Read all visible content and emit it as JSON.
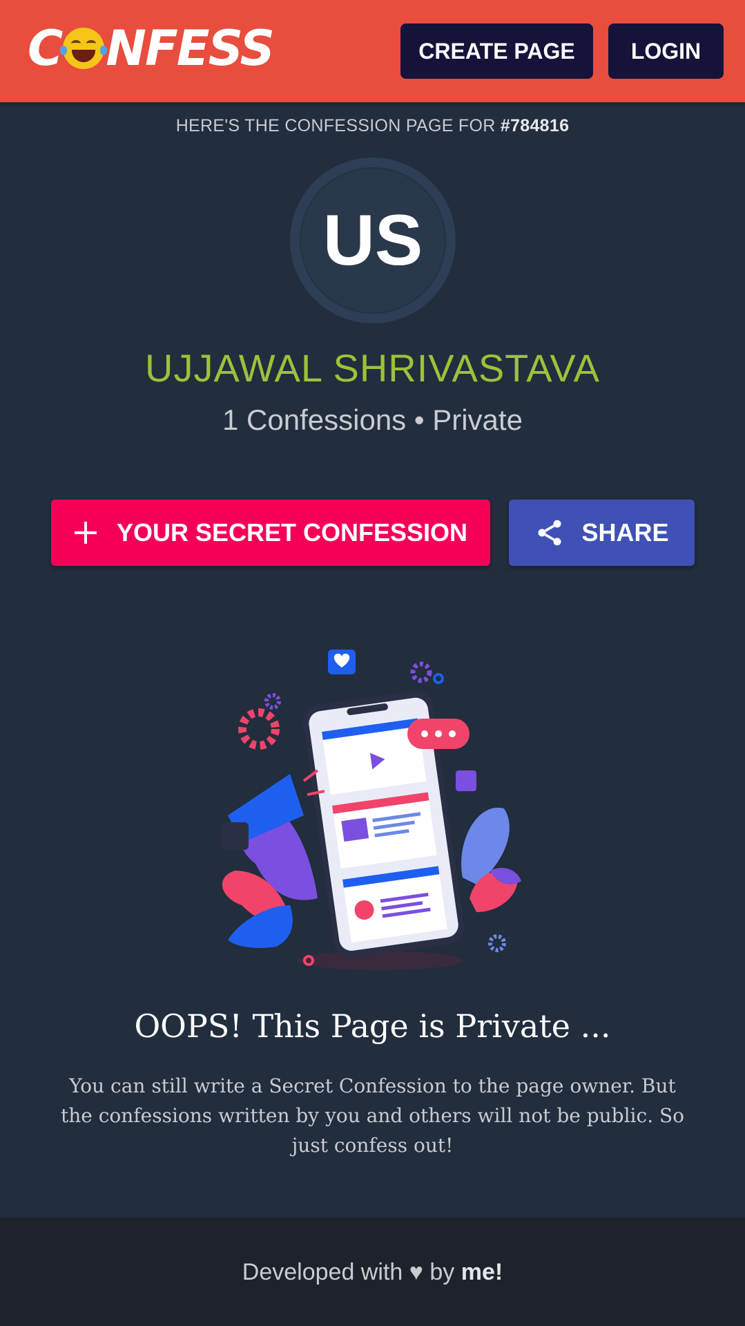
{
  "header": {
    "logo_text_start": "C",
    "logo_text_end": "NFESS",
    "create_page_label": "CREATE PAGE",
    "login_label": "LOGIN",
    "accent_color": "#e84d3d"
  },
  "profile": {
    "subtitle_prefix": "HERE'S THE CONFESSION PAGE FOR ",
    "page_id": "#784816",
    "initials": "US",
    "name": "UJJAWAL SHRIVASTAVA",
    "stats": "1 Confessions • Private"
  },
  "actions": {
    "confess_label": "YOUR SECRET CONFESSION",
    "share_label": "SHARE"
  },
  "private_notice": {
    "title": "OOPS! This Page is Private ...",
    "description": "You can still write a Secret Confession to the page owner. But the confessions written by you and others will not be public. So just confess out!"
  },
  "footer": {
    "text_prefix": "Developed with ",
    "heart": "♥",
    "text_mid": " by ",
    "author": "me!"
  }
}
